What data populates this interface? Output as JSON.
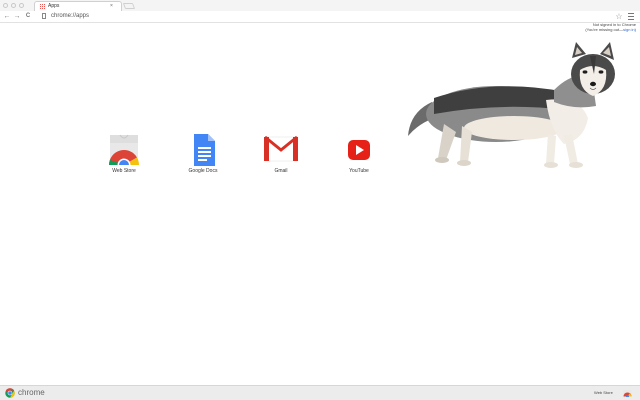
{
  "tab": {
    "title": "Apps",
    "close": "×"
  },
  "toolbar": {
    "back": "←",
    "forward": "→",
    "reload": "C",
    "url": "chrome://apps",
    "star": "☆"
  },
  "signin": {
    "line1": "Not signed in to Chrome",
    "line2_prefix": "(You're missing out—",
    "line2_link": "sign in",
    "line2_suffix": ")"
  },
  "apps": [
    {
      "label": "Web Store",
      "icon": "web-store-icon"
    },
    {
      "label": "Google Docs",
      "icon": "google-docs-icon"
    },
    {
      "label": "Gmail",
      "icon": "gmail-icon"
    },
    {
      "label": "YouTube",
      "icon": "youtube-icon"
    }
  ],
  "bottombar": {
    "brand": "chrome",
    "store_link": "Web Store"
  },
  "colors": {
    "chrome_red": "#db4437",
    "chrome_yellow": "#f4c20d",
    "chrome_green": "#0f9d58",
    "chrome_blue": "#4285f4",
    "docs_blue": "#4285f4",
    "gmail_red": "#d93025",
    "youtube_red": "#e62117"
  }
}
